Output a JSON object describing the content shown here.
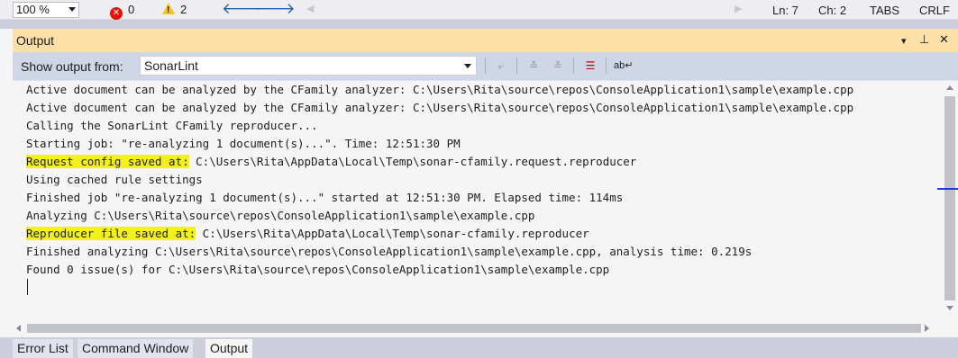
{
  "statusbar": {
    "zoom": "100 %",
    "errors": "0",
    "warnings": "2",
    "ln": "Ln: 7",
    "ch": "Ch: 2",
    "indent": "TABS",
    "eol": "CRLF",
    "icons": {
      "error": "error-icon",
      "warning": "warning-icon",
      "back": "navigate-backward-icon",
      "forward": "navigate-forward-icon"
    }
  },
  "panel": {
    "title": "Output",
    "controls": {
      "menu": "▾",
      "pin": "⊥",
      "close": "✕"
    }
  },
  "toolbar": {
    "show_output_label": "Show output from:",
    "source": "SonarLint",
    "icons": [
      "find-message-in-code-icon",
      "previous-message-icon",
      "next-message-icon",
      "clear-all-icon",
      "toggle-word-wrap-icon"
    ]
  },
  "output": {
    "lines": [
      {
        "pre": "",
        "hl": "",
        "text": "Active document can be analyzed by the CFamily analyzer: C:\\Users\\Rita\\source\\repos\\ConsoleApplication1\\sample\\example.cpp"
      },
      {
        "pre": "",
        "hl": "",
        "text": "Active document can be analyzed by the CFamily analyzer: C:\\Users\\Rita\\source\\repos\\ConsoleApplication1\\sample\\example.cpp"
      },
      {
        "pre": "",
        "hl": "",
        "text": "Calling the SonarLint CFamily reproducer..."
      },
      {
        "pre": "",
        "hl": "",
        "text": "Starting job: \"re-analyzing 1 document(s)...\". Time: 12:51:30 PM"
      },
      {
        "pre": "",
        "hl": "Request config saved at:",
        "text": " C:\\Users\\Rita\\AppData\\Local\\Temp\\sonar-cfamily.request.reproducer"
      },
      {
        "pre": "",
        "hl": "",
        "text": "Using cached rule settings"
      },
      {
        "pre": "",
        "hl": "",
        "text": "Finished job \"re-analyzing 1 document(s)...\" started at 12:51:30 PM. Elapsed time: 114ms"
      },
      {
        "pre": "",
        "hl": "",
        "text": "Analyzing C:\\Users\\Rita\\source\\repos\\ConsoleApplication1\\sample\\example.cpp"
      },
      {
        "pre": "",
        "hl": "Reproducer file saved at:",
        "text": " C:\\Users\\Rita\\AppData\\Local\\Temp\\sonar-cfamily.reproducer"
      },
      {
        "pre": "",
        "hl": "",
        "text": "Finished analyzing C:\\Users\\Rita\\source\\repos\\ConsoleApplication1\\sample\\example.cpp, analysis time: 0.219s"
      },
      {
        "pre": "",
        "hl": "",
        "text": "Found 0 issue(s) for C:\\Users\\Rita\\source\\repos\\ConsoleApplication1\\sample\\example.cpp"
      }
    ],
    "highlight_color": "#f2f218"
  },
  "bottom_tabs": [
    {
      "label": "Error List",
      "active": false
    },
    {
      "label": "Command Window",
      "active": false
    },
    {
      "label": "Output",
      "active": true
    }
  ],
  "colors": {
    "titlebar": "#fddfa8",
    "toolbar": "#cfd6e5",
    "accent": "#1c5fb4"
  }
}
